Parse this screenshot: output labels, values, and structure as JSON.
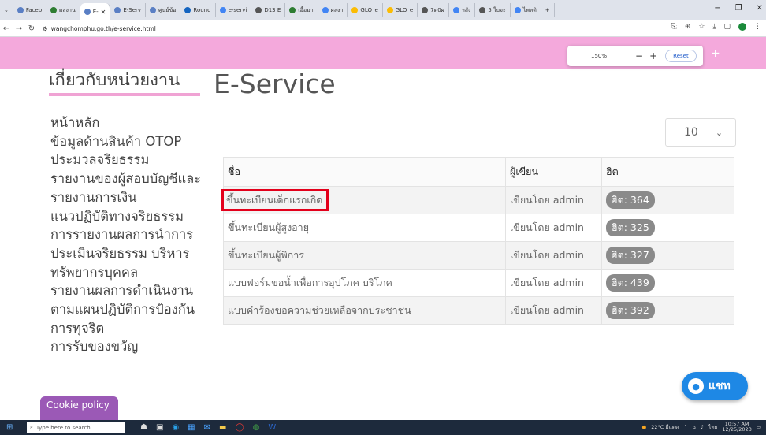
{
  "browser": {
    "tabs": [
      {
        "label": "Faceb"
      },
      {
        "label": "ผลงาน"
      },
      {
        "label": "E-",
        "active": true
      },
      {
        "label": "E-Serv"
      },
      {
        "label": "ศูนย์ข้อ"
      },
      {
        "label": "Round"
      },
      {
        "label": "e-servi"
      },
      {
        "label": "D13 E"
      },
      {
        "label": "เอื้อมา"
      },
      {
        "label": "ผลงา"
      },
      {
        "label": "GLO_e"
      },
      {
        "label": "GLO_e"
      },
      {
        "label": "7ด0ผ"
      },
      {
        "label": "ฯสัง"
      },
      {
        "label": "5 ใบจะ"
      },
      {
        "label": "ไพลติ"
      }
    ],
    "new_tab": "+",
    "url": "wangchomphu.go.th/e-service.html",
    "zoom": {
      "level": "150%",
      "minus": "−",
      "plus": "+",
      "reset_label": "Reset"
    }
  },
  "sidebar": {
    "title": "เกี่ยวกับหน่วยงาน",
    "items": [
      "หน้าหลัก",
      "ข้อมูลด้านสินค้า OTOP",
      "ประมวลจริยธรรม",
      "รายงานของผู้สอบบัญชีและ",
      "รายงานการเงิน",
      "แนวปฏิบัติทางจริยธรรม",
      "การรายงานผลการนำการ",
      "ประเมินจริยธรรม บริหาร",
      "ทรัพยากรบุคคล",
      "รายงานผลการดำเนินงาน",
      "ตามแผนปฏิบัติการป้องกัน",
      "การทุจริต",
      "การรับของขวัญ"
    ]
  },
  "main": {
    "title": "E-Service",
    "page_size": "10",
    "columns": [
      "ชื่อ",
      "ผู้เขียน",
      "ฮิต"
    ],
    "rows": [
      {
        "name": "ขึ้นทะเบียนเด็กแรกเกิด",
        "author": "เขียนโดย admin",
        "hits": "ฮิต: 364"
      },
      {
        "name": "ขึ้นทะเบียนผู้สูงอายุ",
        "author": "เขียนโดย admin",
        "hits": "ฮิต: 325"
      },
      {
        "name": "ขึ้นทะเบียนผู้พิการ",
        "author": "เขียนโดย admin",
        "hits": "ฮิต: 327"
      },
      {
        "name": "แบบฟอร์มขอน้ำเพื่อการอุปโภค บริโภค",
        "author": "เขียนโดย admin",
        "hits": "ฮิต: 439"
      },
      {
        "name": "แบบคำร้องขอความช่วยเหลือจากประชาชน",
        "author": "เขียนโดย admin",
        "hits": "ฮิต: 392"
      }
    ]
  },
  "chat": {
    "label": "แชท"
  },
  "cookie": {
    "label": "Cookie policy"
  },
  "taskbar": {
    "search_placeholder": "Type here to search",
    "weather": "22°C มีแดด",
    "time": "10:57 AM",
    "date": "12/25/2023",
    "lang": "ไทย"
  },
  "colors": {
    "accent_pink": "#f4a9dc",
    "highlight_red": "#e3001b",
    "chat_blue": "#1e88e5",
    "cookie_purple": "#9b59b6"
  }
}
